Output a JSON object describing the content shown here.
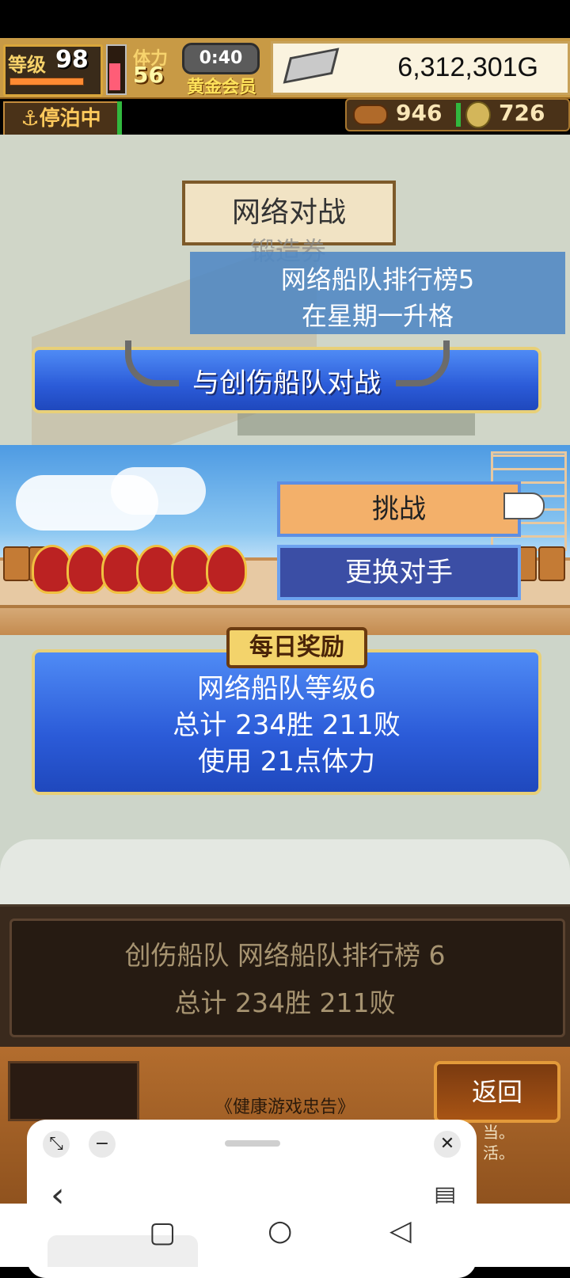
{
  "hud": {
    "level_label": "等级",
    "level": "98",
    "stamina_label": "体力",
    "stamina": "56",
    "timer": "0:40",
    "membership": "黄金会员",
    "money": "6,312,301G",
    "moored_status": "停泊中",
    "resource1": "946",
    "resource2": "726"
  },
  "top": {
    "net_battle_title": "网络对战",
    "faded_label": "锻造券",
    "ranking_line1": "网络船队排行榜5",
    "ranking_line2": "在星期一升格",
    "fight_button": "与创伤船队对战"
  },
  "mid": {
    "challenge_button": "挑战",
    "change_opponent_button": "更换对手"
  },
  "daily": {
    "tag": "每日奖励",
    "line1": "网络船队等级6",
    "line2": "总计 234胜 211败",
    "line3": "使用 21点体力"
  },
  "panel": {
    "line1": "创伤船队  网络船队排行榜  6",
    "line2": "总计 234胜 211败"
  },
  "footer": {
    "back_button": "返回",
    "health_notice": "《健康游戏忠告》",
    "stray1": "当。",
    "stray2": "活。"
  },
  "floating_window": {
    "expand_icon": "⤡",
    "minimize_icon": "−",
    "close_icon": "✕",
    "back_icon": "‹",
    "clipboard_icon": "▤"
  },
  "nav": {
    "recent_icon": "▢",
    "home_icon": "○",
    "back_icon": "◁"
  },
  "colors": {
    "blue_button": "#2b5bd8",
    "challenge_orange": "#f3b06a",
    "change_blue": "#3b4ea5",
    "panel_brown": "#3a2a1d",
    "back_orange": "#a85414"
  }
}
